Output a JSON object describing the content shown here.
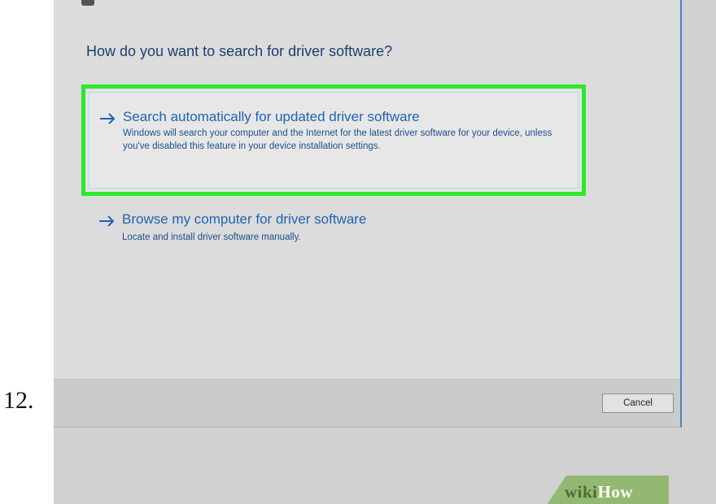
{
  "step_number": "12.",
  "dialog": {
    "heading": "How do you want to search for driver software?",
    "options": [
      {
        "title": "Search automatically for updated driver software",
        "description": "Windows will search your computer and the Internet for the latest driver software for your device, unless you've disabled this feature in your device installation settings."
      },
      {
        "title": "Browse my computer for driver software",
        "description": "Locate and install driver software manually."
      }
    ],
    "cancel_label": "Cancel"
  },
  "colors": {
    "highlight": "#2aea2a",
    "link_blue": "#1e64b5",
    "dialog_background": "#dcdcdc",
    "wikihow_green": "#93b871"
  },
  "watermark": {
    "wiki": "wiki",
    "how": "How"
  }
}
